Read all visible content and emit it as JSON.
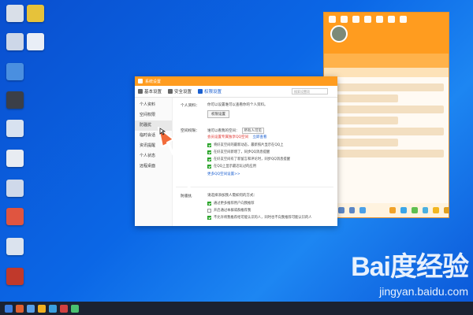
{
  "dialog": {
    "title": "系统设置",
    "tabs": [
      {
        "label": "基本设置",
        "icon": "gear-icon"
      },
      {
        "label": "安全设置",
        "icon": "shield-icon"
      },
      {
        "label": "权限设置",
        "icon": "lock-icon",
        "active": true
      }
    ],
    "search_placeholder": "搜索设置项",
    "nav": [
      "个人资料",
      "空间权限",
      "防骚扰",
      "临时会话",
      "资讯提醒",
      "个人状态",
      "远程桌面"
    ],
    "selected_nav": "防骚扰",
    "profile": {
      "label": "个人资料：",
      "text": "你可以设置谁可以查看你的个人资料。",
      "button": "权限设置"
    },
    "space": {
      "label": "空间权限：",
      "visibility_label": "谁可以看我的空间：",
      "visibility_value": "所有人可见",
      "red_text": "会员设置专属独享QQ空间",
      "blue_text": "立即查看",
      "options": [
        {
          "label": "将好友空间的最新动态，最新照片显示在QQ上",
          "checked": true
        },
        {
          "label": "在好友空间新增了，同步QQ消息提醒",
          "checked": true
        },
        {
          "label": "在好友空间有了新留言和评论时，同步QQ消息提醒",
          "checked": true
        },
        {
          "label": "在QQ上显示最近玩过的应用",
          "checked": true
        }
      ],
      "more_link": "更多QQ空间设置>>"
    },
    "anti": {
      "label": "防骚扰：",
      "intro": "请选择添加我人需如何的方式：",
      "options": [
        {
          "label": "通过更多推荐用户向我推荐",
          "checked": true
        },
        {
          "label": "开启通过本群或群推荐我",
          "checked": false
        },
        {
          "label": "不允许将我推荐给可能认识的人，同时也不向我推荐可能认识的人",
          "checked": true
        }
      ]
    }
  },
  "watermark": {
    "logo": "Bai度经验",
    "url": "jingyan.baidu.com"
  },
  "colors": {
    "accent": "#ff9c1f",
    "desktop": "#0b67e6",
    "arrow": "#f26b3a",
    "link": "#1a5fd0",
    "checked": "#27a327"
  }
}
